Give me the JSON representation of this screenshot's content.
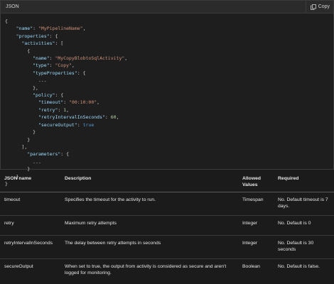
{
  "code_block": {
    "language": "JSON",
    "copy_label": "Copy",
    "lines": [
      [
        {
          "t": "{",
          "c": "p"
        }
      ],
      [
        {
          "t": "    ",
          "c": "p"
        },
        {
          "t": "\"name\"",
          "c": "k"
        },
        {
          "t": ": ",
          "c": "p"
        },
        {
          "t": "\"MyPipelineName\"",
          "c": "s"
        },
        {
          "t": ",",
          "c": "p"
        }
      ],
      [
        {
          "t": "    ",
          "c": "p"
        },
        {
          "t": "\"properties\"",
          "c": "k"
        },
        {
          "t": ": {",
          "c": "p"
        }
      ],
      [
        {
          "t": "      ",
          "c": "p"
        },
        {
          "t": "\"activities\"",
          "c": "k"
        },
        {
          "t": ": [",
          "c": "p"
        }
      ],
      [
        {
          "t": "        {",
          "c": "p"
        }
      ],
      [
        {
          "t": "          ",
          "c": "p"
        },
        {
          "t": "\"name\"",
          "c": "k"
        },
        {
          "t": ": ",
          "c": "p"
        },
        {
          "t": "\"MyCopyBlobtoSqlActivity\"",
          "c": "s"
        },
        {
          "t": ",",
          "c": "p"
        }
      ],
      [
        {
          "t": "          ",
          "c": "p"
        },
        {
          "t": "\"type\"",
          "c": "k"
        },
        {
          "t": ": ",
          "c": "p"
        },
        {
          "t": "\"Copy\"",
          "c": "s"
        },
        {
          "t": ",",
          "c": "p"
        }
      ],
      [
        {
          "t": "          ",
          "c": "p"
        },
        {
          "t": "\"typeProperties\"",
          "c": "k"
        },
        {
          "t": ": {",
          "c": "p"
        }
      ],
      [
        {
          "t": "            ...",
          "c": "p"
        }
      ],
      [
        {
          "t": "          },",
          "c": "p"
        }
      ],
      [
        {
          "t": "          ",
          "c": "p"
        },
        {
          "t": "\"policy\"",
          "c": "k"
        },
        {
          "t": ": {",
          "c": "p"
        }
      ],
      [
        {
          "t": "            ",
          "c": "p"
        },
        {
          "t": "\"timeout\"",
          "c": "k"
        },
        {
          "t": ": ",
          "c": "p"
        },
        {
          "t": "\"00:10:00\"",
          "c": "s"
        },
        {
          "t": ",",
          "c": "p"
        }
      ],
      [
        {
          "t": "            ",
          "c": "p"
        },
        {
          "t": "\"retry\"",
          "c": "k"
        },
        {
          "t": ": ",
          "c": "p"
        },
        {
          "t": "1",
          "c": "n"
        },
        {
          "t": ",",
          "c": "p"
        }
      ],
      [
        {
          "t": "            ",
          "c": "p"
        },
        {
          "t": "\"retryIntervalInSeconds\"",
          "c": "k"
        },
        {
          "t": ": ",
          "c": "p"
        },
        {
          "t": "60",
          "c": "n"
        },
        {
          "t": ",",
          "c": "p"
        }
      ],
      [
        {
          "t": "            ",
          "c": "p"
        },
        {
          "t": "\"secureOutput\"",
          "c": "k"
        },
        {
          "t": ": ",
          "c": "p"
        },
        {
          "t": "true",
          "c": "b"
        }
      ],
      [
        {
          "t": "          }",
          "c": "p"
        }
      ],
      [
        {
          "t": "        }",
          "c": "p"
        }
      ],
      [
        {
          "t": "      ],",
          "c": "p"
        }
      ],
      [
        {
          "t": "        ",
          "c": "p"
        },
        {
          "t": "\"parameters\"",
          "c": "k"
        },
        {
          "t": ": {",
          "c": "p"
        }
      ],
      [
        {
          "t": "          ...",
          "c": "p"
        }
      ],
      [
        {
          "t": "        }",
          "c": "p"
        }
      ],
      [
        {
          "t": "    }",
          "c": "p"
        }
      ],
      [
        {
          "t": "}",
          "c": "p"
        }
      ]
    ]
  },
  "table": {
    "headers": [
      "JSON name",
      "Description",
      "Allowed Values",
      "Required"
    ],
    "rows": [
      [
        "timeout",
        "Specifies the timeout for the activity to run.",
        "Timespan",
        "No. Default timeout is 7 days."
      ],
      [
        "retry",
        "Maximum retry attempts",
        "Integer",
        "No. Default is 0"
      ],
      [
        "retryIntervalInSeconds",
        "The delay between retry attempts in seconds",
        "Integer",
        "No. Default is 30 seconds"
      ],
      [
        "secureOutput",
        "When set to true, the output from activity is considered as secure and aren't logged for monitoring.",
        "Boolean",
        "No. Default is false."
      ]
    ]
  }
}
